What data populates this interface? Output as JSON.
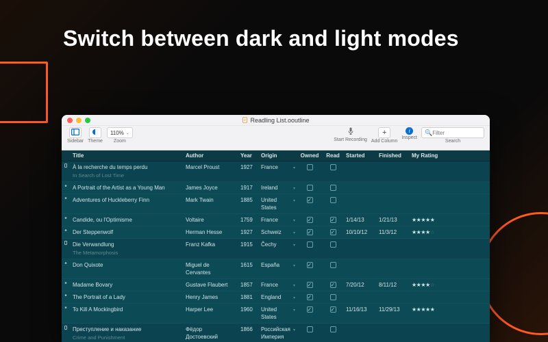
{
  "headline": "Switch between dark and light modes",
  "window": {
    "title": "Readling List.ooutline"
  },
  "toolbar": {
    "sidebar_label": "Sidebar",
    "theme_label": "Theme",
    "zoom_label": "Zoom",
    "zoom_value": "110%",
    "start_recording_label": "Start Recording",
    "add_column_label": "Add Column",
    "inspect_label": "Inspect",
    "search_label": "Search",
    "search_placeholder": "Filter"
  },
  "columns": {
    "title": "Title",
    "author": "Author",
    "year": "Year",
    "origin": "Origin",
    "owned": "Owned",
    "read": "Read",
    "started": "Started",
    "finished": "Finished",
    "rating": "My Rating"
  },
  "rows": [
    {
      "type": "group",
      "title": "À la recherche du temps perdu",
      "subtitle": "In Search of Lost Time",
      "author": "Marcel Proust",
      "year": "1927",
      "origin": "France",
      "owned": false,
      "read": false,
      "started": "",
      "finished": "",
      "rating": ""
    },
    {
      "type": "item",
      "title": "A Portrait of the Artist as a Young Man",
      "author": "James Joyce",
      "year": "1917",
      "origin": "Ireland",
      "owned": false,
      "read": false,
      "started": "",
      "finished": "",
      "rating": ""
    },
    {
      "type": "item",
      "title": "Adventures of Huckleberry Finn",
      "author": "Mark Twain",
      "year": "1885",
      "origin": "United States",
      "owned": true,
      "read": false,
      "started": "",
      "finished": "",
      "rating": ""
    },
    {
      "type": "item",
      "title": "Candide, ou l'Optimisme",
      "author": "Voltaire",
      "year": "1759",
      "origin": "France",
      "owned": true,
      "read": true,
      "started": "1/14/13",
      "finished": "1/21/13",
      "rating": "★★★★★"
    },
    {
      "type": "item",
      "title": "Der Steppenwolf",
      "author": "Herman Hesse",
      "year": "1927",
      "origin": "Schweiz",
      "owned": true,
      "read": true,
      "started": "10/10/12",
      "finished": "11/3/12",
      "rating": "★★★★☆"
    },
    {
      "type": "group",
      "title": "Die Verwandlung",
      "subtitle": "The Metamorphosis",
      "author": "Franz Kafka",
      "year": "1915",
      "origin": "Čechy",
      "owned": false,
      "read": false,
      "started": "",
      "finished": "",
      "rating": ""
    },
    {
      "type": "item",
      "title": "Don Quixote",
      "author": "Miguel de Cervantes",
      "year": "1615",
      "origin": "España",
      "owned": true,
      "read": false,
      "started": "",
      "finished": "",
      "rating": ""
    },
    {
      "type": "item",
      "title": "Madame Bovary",
      "author": "Gustave Flaubert",
      "year": "1857",
      "origin": "France",
      "owned": true,
      "read": true,
      "started": "7/20/12",
      "finished": "8/11/12",
      "rating": "★★★★☆"
    },
    {
      "type": "item",
      "title": "The Portrait of a Lady",
      "author": "Henry James",
      "year": "1881",
      "origin": "England",
      "owned": true,
      "read": false,
      "started": "",
      "finished": "",
      "rating": ""
    },
    {
      "type": "item",
      "title": "To Kill A Mockingbird",
      "author": "Harper Lee",
      "year": "1960",
      "origin": "United States",
      "owned": true,
      "read": true,
      "started": "11/16/13",
      "finished": "11/29/13",
      "rating": "★★★★★"
    },
    {
      "type": "group",
      "title": "Преступление и наказание",
      "subtitle": "Crime and Punishment",
      "author": "Фёдор Достоевский",
      "year": "1866",
      "origin": "Российская Империя",
      "owned": false,
      "read": false,
      "started": "",
      "finished": "",
      "rating": ""
    }
  ]
}
